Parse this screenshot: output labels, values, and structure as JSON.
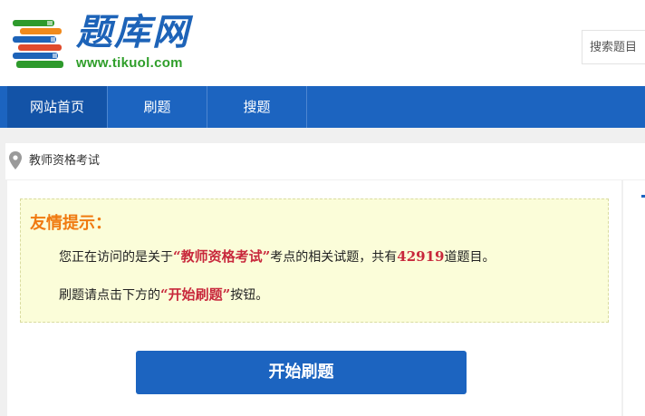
{
  "header": {
    "logo_title": "题库网",
    "logo_url": "www.tikuol.com",
    "search_placeholder": "搜索题目"
  },
  "nav": {
    "items": [
      {
        "label": "网站首页",
        "active": true
      },
      {
        "label": "刷题",
        "active": false
      },
      {
        "label": "搜题",
        "active": false
      }
    ]
  },
  "breadcrumb": {
    "icon": "map-pin-icon",
    "label": "教师资格考试"
  },
  "tips": {
    "title": "友情提示：",
    "line1_prefix": "您正在访问的是关于",
    "line1_topic": "“教师资格考试”",
    "line1_middle": "考点的相关试题，共有",
    "line1_count": "42919",
    "line1_suffix": "道题目。",
    "line2_prefix": "刷题请点击下方的",
    "line2_highlight": "“开始刷题”",
    "line2_suffix": "按钮。"
  },
  "actions": {
    "start_label": "开始刷题"
  },
  "colors": {
    "brand_blue": "#1c64c0",
    "nav_active": "#1353a7",
    "logo_green": "#2f9e2a",
    "tip_title": "#f07a10",
    "highlight_red": "#c8283c",
    "tip_bg": "#fbfdd9"
  }
}
